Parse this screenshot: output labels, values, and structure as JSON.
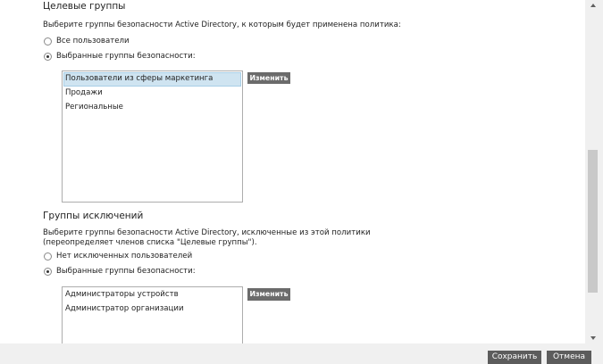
{
  "target": {
    "heading": "Целевые группы",
    "description": "Выберите группы безопасности Active Directory, к которым будет применена политика:",
    "options": [
      {
        "label": "Все пользователи",
        "selected": false
      },
      {
        "label": "Выбранные группы безопасности:",
        "selected": true
      }
    ],
    "list": [
      "Пользователи из сферы маркетинга",
      "Продажи",
      "Региональные"
    ],
    "selected_index": 0,
    "edit_label": "Изменить"
  },
  "exclusions": {
    "heading": "Группы исключений",
    "description_line1": "Выберите группы безопасности Active Directory, исключенные из этой политики",
    "description_line2": "(переопределяет членов списка \"Целевые группы\").",
    "options": [
      {
        "label": "Нет исключенных пользователей",
        "selected": false
      },
      {
        "label": "Выбранные группы безопасности:",
        "selected": true
      }
    ],
    "list": [
      "Администраторы устройств",
      "Администратор организации"
    ],
    "edit_label": "Изменить"
  },
  "footer": {
    "save_label": "Сохранить",
    "cancel_label": "Отмена"
  }
}
